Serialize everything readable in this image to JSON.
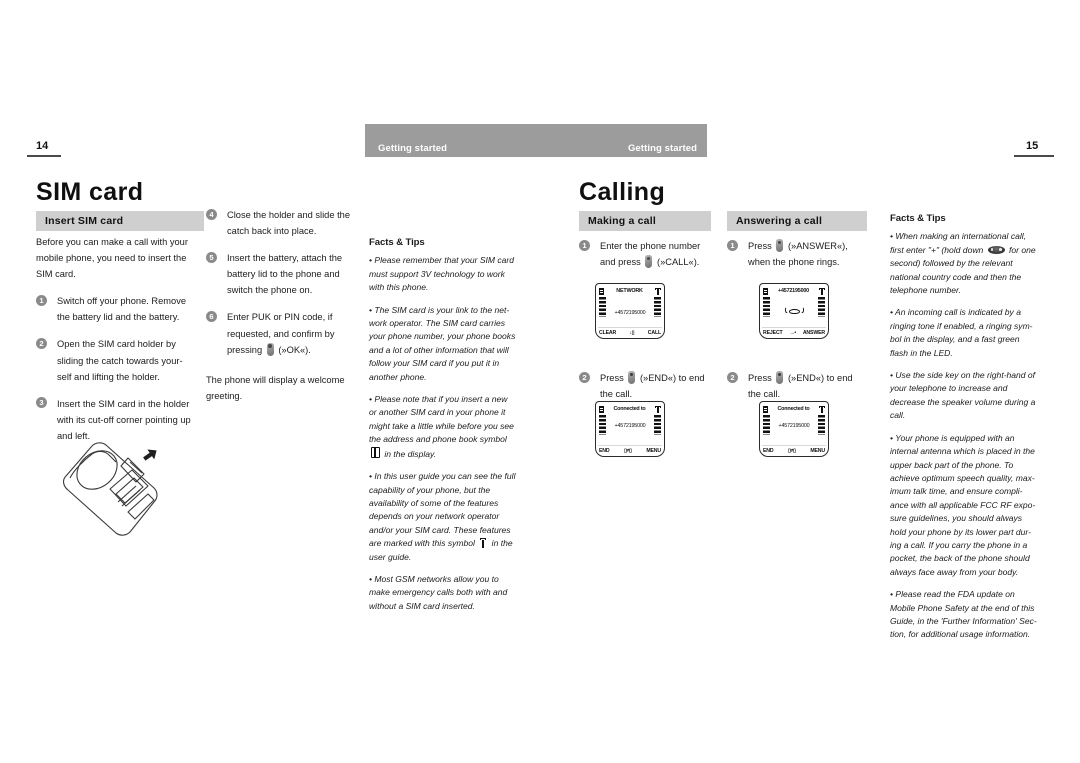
{
  "header": {
    "left_label": "Getting started",
    "right_label": "Getting started",
    "band_color": "#9c9c9c"
  },
  "folios": {
    "left": "14",
    "right": "15"
  },
  "left_page": {
    "title": "SIM card",
    "section_heading": "Insert SIM card",
    "intro": "Before you can make a call with your mobile phone, you need to insert the SIM card.",
    "steps": [
      {
        "num": "1",
        "text": "Switch off your phone. Remove the battery lid and the battery."
      },
      {
        "num": "2",
        "text": "Open the SIM card holder by sliding the catch towards your-self and lifting the holder."
      },
      {
        "num": "3",
        "text": "Insert the SIM card in the holder with its cut-off corner pointing up and left."
      },
      {
        "num": "4",
        "text": "Close the holder and slide the catch back into place."
      },
      {
        "num": "5",
        "text": "Insert the battery, attach the battery lid to the phone and switch the phone on."
      },
      {
        "num": "6",
        "text_before": "Enter PUK or PIN code, if requested, and confirm by pressing ",
        "key_icon": "select-key-icon",
        "text_after": " (»OK«)."
      }
    ],
    "closing": "The phone will display a welcome greeting.",
    "facts": {
      "title": "Facts & Tips",
      "items": [
        "• Please remember that your SIM card must support 3V technology to work with this phone.",
        "• The SIM card is your link to the net-work operator. The SIM card carries your phone number, your phone books and a lot of other information that will follow your SIM card if you put it in another phone.",
        "• Please note that if you insert a new or another SIM card in your phone it might take a little while before you see the address and phone book symbol    in the display.",
        "• In this user guide you can see the full capability of your phone, but the availability of some of the features depends on your network operator and/or your SIM card. These features are marked with this symbol    in the user guide.",
        "• Most GSM networks allow you to make emergency calls both with and without a SIM card inserted."
      ]
    }
  },
  "right_page": {
    "title": "Calling",
    "making": {
      "heading": "Making a call",
      "steps": [
        {
          "num": "1",
          "text_before": "Enter the phone number and press ",
          "key_icon": "call-key-icon",
          "text_after": " (»CALL«)."
        },
        {
          "num": "2",
          "text_before": "Press ",
          "key_icon": "end-key-icon",
          "text_after": " (»END«) to end the call."
        }
      ]
    },
    "answering": {
      "heading": "Answering a call",
      "steps": [
        {
          "num": "1",
          "text_before": "Press ",
          "key_icon": "answer-key-icon",
          "text_after": " (»ANSWER«), when the phone rings."
        },
        {
          "num": "2",
          "text_before": "Press ",
          "key_icon": "end-key-icon",
          "text_after": " (»END«) to end the call."
        }
      ]
    },
    "screens": [
      {
        "id": "screen-dial",
        "title": "NETWORK",
        "body": "+4572195000",
        "soft_left": "CLEAR",
        "soft_mid": "↓▯",
        "soft_right": "CALL"
      },
      {
        "id": "screen-incoming",
        "title": "+4572195000",
        "body": "",
        "soft_left": "REJECT",
        "soft_mid": "→•",
        "soft_right": "ANSWER"
      },
      {
        "id": "screen-connected-left",
        "title": "Connected to",
        "body": "+4572195000",
        "soft_left": "END",
        "soft_mid": "▯≠▯",
        "soft_right": "MENU"
      },
      {
        "id": "screen-connected-right",
        "title": "Connected to",
        "body": "+4572195000",
        "soft_left": "END",
        "soft_mid": "▯≠▯",
        "soft_right": "MENU"
      }
    ],
    "facts": {
      "title": "Facts & Tips",
      "items": [
        "• When making an international call, first enter \"+\" (hold down    for one second) followed by the relevant national country code and then the telephone number.",
        "• An incoming call is indicated by a ringing tone if enabled, a ringing sym-bol in the display, and a fast green flash in the LED.",
        "• Use the side key on the right-hand of your telephone to increase and decrease the speaker volume during a call.",
        "• Your phone is equipped with an internal antenna which is placed in the upper back part of the phone. To achieve optimum speech quality, max-imum talk time, and ensure compli-ance with all applicable FCC RF expo-sure guidelines, you should always hold your phone by its lower part dur-ing a call. If you carry the phone in a pocket, the back of the phone should always face away from your body.",
        "• Please read the FDA update on Mobile Phone Safety at the end of this Guide, in the 'Further Information' Sec-tion, for additional usage information."
      ]
    }
  }
}
